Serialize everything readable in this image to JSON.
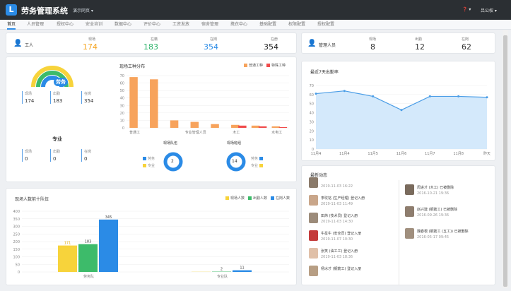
{
  "app": {
    "title": "劳务管理系统",
    "project": "演示网页 ▾",
    "help": "❓ ▾",
    "user": "吕公权 ▾"
  },
  "nav": [
    "首页",
    "人员管理",
    "授权中心",
    "安全培训",
    "数据中心",
    "评价中心",
    "工资发放",
    "宿舍管理",
    "携衣中心",
    "基础配置",
    "权限配置",
    "授权配置"
  ],
  "workers": {
    "title": "工人",
    "labels": [
      "现场",
      "在籍",
      "在岗",
      "在册"
    ],
    "values": [
      "174",
      "183",
      "354",
      "354"
    ],
    "colors": [
      "#f5a623",
      "#2db36a",
      "#2b8be6",
      "#222222"
    ]
  },
  "managers": {
    "title": "管理人员",
    "labels": [
      "现场",
      "出勤",
      "在岗"
    ],
    "values": [
      "8",
      "12",
      "62"
    ]
  },
  "gauges": {
    "labor": {
      "title": "劳务",
      "labels": [
        "现场",
        "出勤",
        "在岗"
      ],
      "values": [
        "174",
        "183",
        "354"
      ]
    },
    "pro": {
      "title": "专业",
      "labels": [
        "现场",
        "出勤",
        "在岗"
      ],
      "values": [
        "0",
        "0",
        "0"
      ]
    }
  },
  "dist": {
    "title": "现场工种分布",
    "legend": [
      "普通工种",
      "特殊工种"
    ],
    "colors": [
      "#f7a35c",
      "#f04b4b"
    ],
    "chart_data": {
      "type": "bar",
      "ylim": [
        0,
        70
      ],
      "yticks": [
        "0",
        "10",
        "20",
        "30",
        "40",
        "50",
        "60",
        "70"
      ],
      "xlabels": [
        "普通工",
        "专业管理人员",
        "木工",
        "水电工"
      ],
      "series": [
        {
          "name": "普通工种",
          "values": [
            68,
            65,
            10,
            8,
            5,
            4,
            3,
            2
          ]
        },
        {
          "name": "特殊工种",
          "values": [
            0,
            0,
            0,
            0,
            0,
            3,
            2,
            1
          ]
        }
      ]
    }
  },
  "donuts": [
    {
      "title": "现场队伍",
      "value": "2",
      "legend": [
        "劳务",
        "专业"
      ]
    },
    {
      "title": "现场班组",
      "value": "14",
      "legend": [
        "劳务",
        "专业"
      ]
    }
  ],
  "attendance": {
    "title": "最近7天出勤率",
    "chart_data": {
      "type": "area",
      "ylim": [
        0,
        70
      ],
      "yticks": [
        "0",
        "10",
        "20",
        "30",
        "40",
        "50",
        "60",
        "70"
      ],
      "x": [
        "11月4",
        "11月4",
        "11月5",
        "11月6",
        "11月7",
        "11月8",
        "昨天"
      ],
      "values": [
        61,
        64,
        58,
        43,
        58,
        58,
        57
      ]
    }
  },
  "crew": {
    "title": "现场人数前十队伍",
    "legend": [
      "现场人数",
      "出勤人数",
      "在岗人数"
    ],
    "colors": [
      "#f7d33b",
      "#3dbb6a",
      "#2b8be6"
    ],
    "chart_data": {
      "type": "bar",
      "ylim": [
        0,
        400
      ],
      "yticks": [
        "0",
        "50",
        "100",
        "150",
        "200",
        "250",
        "300",
        "350",
        "400"
      ],
      "categories": [
        "劳务队",
        "专业队"
      ],
      "series": [
        {
          "name": "现场人数",
          "values": [
            174,
            1
          ]
        },
        {
          "name": "出勤人数",
          "values": [
            183,
            2
          ]
        },
        {
          "name": "在岗人数",
          "values": [
            345,
            11
          ]
        }
      ],
      "labels": [
        [
          "171",
          "183",
          "345"
        ],
        [
          "",
          "2",
          "11"
        ]
      ]
    }
  },
  "news": {
    "title": "最新动态",
    "left": [
      {
        "name": "",
        "date": "2019-11-03 16:22",
        "color": "#8a7a6a"
      },
      {
        "name": "李玟铭 (生产经理) 登记入册",
        "date": "2019-11-03 11:49",
        "color": "#c9a68a"
      },
      {
        "name": "田炜 (技术员) 登记入册",
        "date": "2019-11-03 14:30",
        "color": "#9c8b7a"
      },
      {
        "name": "牛星牛 (安全员) 登记入册",
        "date": "2019-11-07 10:30",
        "color": "#c43b3b"
      },
      {
        "name": "张笑 (油工工) 登记入册",
        "date": "2019-11-03 18:36",
        "color": "#e0c0a8"
      },
      {
        "name": "杨冰才 (钢筋工) 登记入册",
        "date": "",
        "color": "#b79e84"
      }
    ],
    "right": [
      {
        "name": "周进才 (木工) 已被删除",
        "date": "2016-10-21 19:36",
        "color": "#7a6b5d"
      },
      {
        "name": "赵兴建 (钢筋工) 已被删除",
        "date": "2016-09-26 19:36",
        "color": "#8e7d6e"
      },
      {
        "name": "魏春根 (钢筋工 (五工)) 已被删除",
        "date": "2016-05-17 09:45",
        "color": "#a08f7e"
      }
    ]
  }
}
